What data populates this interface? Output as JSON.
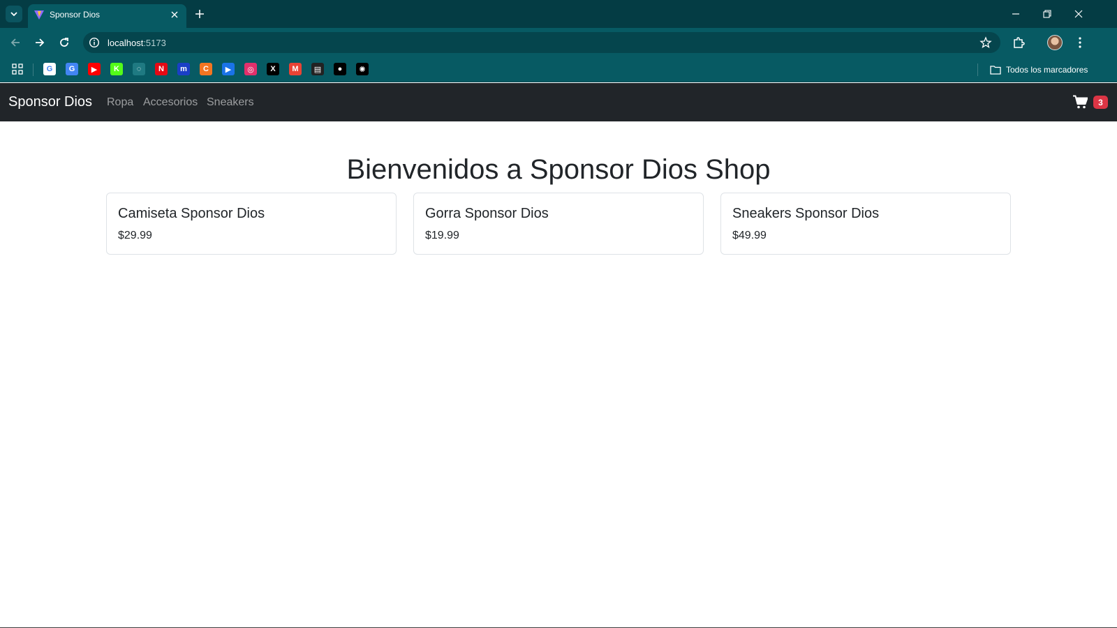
{
  "browser": {
    "tab_title": "Sponsor Dios",
    "url_host": "localhost",
    "url_port": ":5173",
    "all_bookmarks_label": "Todos los marcadores",
    "bookmarks": [
      {
        "name": "google-icon",
        "glyph": "G",
        "color": "#ffffff"
      },
      {
        "name": "translate-icon",
        "glyph": "G",
        "color": "#4285f4"
      },
      {
        "name": "youtube-icon",
        "glyph": "▶",
        "color": "#ff0000"
      },
      {
        "name": "kick-icon",
        "glyph": "K",
        "color": "#53fc18"
      },
      {
        "name": "unknown-bookmark-icon",
        "glyph": "◌",
        "color": "#1f7a82"
      },
      {
        "name": "netflix-icon",
        "glyph": "N",
        "color": "#e50914"
      },
      {
        "name": "m-icon",
        "glyph": "m",
        "color": "#1a3fc6"
      },
      {
        "name": "crunchyroll-icon",
        "glyph": "C",
        "color": "#f47521"
      },
      {
        "name": "play-icon",
        "glyph": "▶",
        "color": "#1a73e8"
      },
      {
        "name": "instagram-icon",
        "glyph": "◎",
        "color": "#e1306c"
      },
      {
        "name": "x-icon",
        "glyph": "X",
        "color": "#000000"
      },
      {
        "name": "gmail-icon",
        "glyph": "M",
        "color": "#ea4335"
      },
      {
        "name": "bookmark-icon",
        "glyph": "▤",
        "color": "#222222"
      },
      {
        "name": "github-icon",
        "glyph": "●",
        "color": "#000000"
      },
      {
        "name": "chatgpt-icon",
        "glyph": "✺",
        "color": "#000000"
      }
    ]
  },
  "navbar": {
    "brand": "Sponsor Dios",
    "links": [
      "Ropa",
      "Accesorios",
      "Sneakers"
    ],
    "cart_count": "3"
  },
  "main": {
    "heading": "Bienvenidos a Sponsor Dios Shop",
    "products": [
      {
        "name": "Camiseta Sponsor Dios",
        "price": "$29.99"
      },
      {
        "name": "Gorra Sponsor Dios",
        "price": "$19.99"
      },
      {
        "name": "Sneakers Sponsor Dios",
        "price": "$49.99"
      }
    ]
  },
  "colors": {
    "tabstrip": "#043c44",
    "toolbar": "#075a63",
    "navbar": "#212529",
    "badge": "#dc3545"
  }
}
